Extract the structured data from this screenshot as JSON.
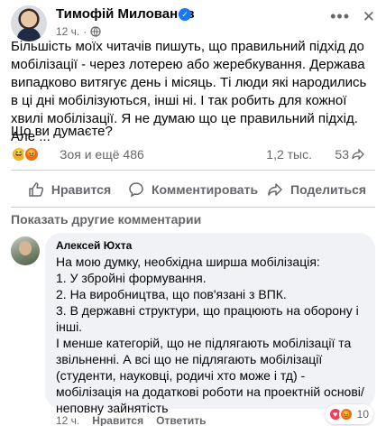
{
  "post": {
    "author": "Тимофій Милованов",
    "time": "12 ч.",
    "text": "Більшість моїх читачів пишуть, що правильний підхід до мобілізації - через лотерею або жеребкування. Держава випадково витягує день і місяць. Ті люди які народились в ці дні мобілізуються, інші ні. І так робить для кожної хвилі мобілізації. Я не думаю що це правильний підхід. Але ...",
    "question": "Що ви думаєте?",
    "icons": [
      "verified-icon",
      "globe-icon",
      "more-icon",
      "close-icon"
    ]
  },
  "reactions": {
    "summary": "Зоя и ещё 486",
    "comments": "1,2 тыс.",
    "shares": "53"
  },
  "actions": {
    "like": "Нравится",
    "comment": "Комментировать",
    "share": "Поделиться"
  },
  "show_more": "Показать другие комментарии",
  "comment": {
    "author": "Алексей Юхта",
    "text": "На мою думку, необхідна ширша мобілізація:\n1. У збройні формування.\n2. На виробництва, що пов'язані з ВПК.\n3. В державні структури, що працюють на оборону і інші.\nІ менше категорій, що не підлягають мобілізації та звільненні. А всі що не підлягають мобілізації (студенти, науковці, родичі хто може і тд) - мобілізація на додаткові роботи на проектній основі/неповну зайнятість",
    "time": "12 ч.",
    "like_label": "Нравится",
    "reply_label": "Ответить",
    "reaction_count": "10"
  },
  "colors": {
    "accent": "#1877f2",
    "secondary_text": "#65676b",
    "bubble_bg": "#f0f2f5"
  }
}
